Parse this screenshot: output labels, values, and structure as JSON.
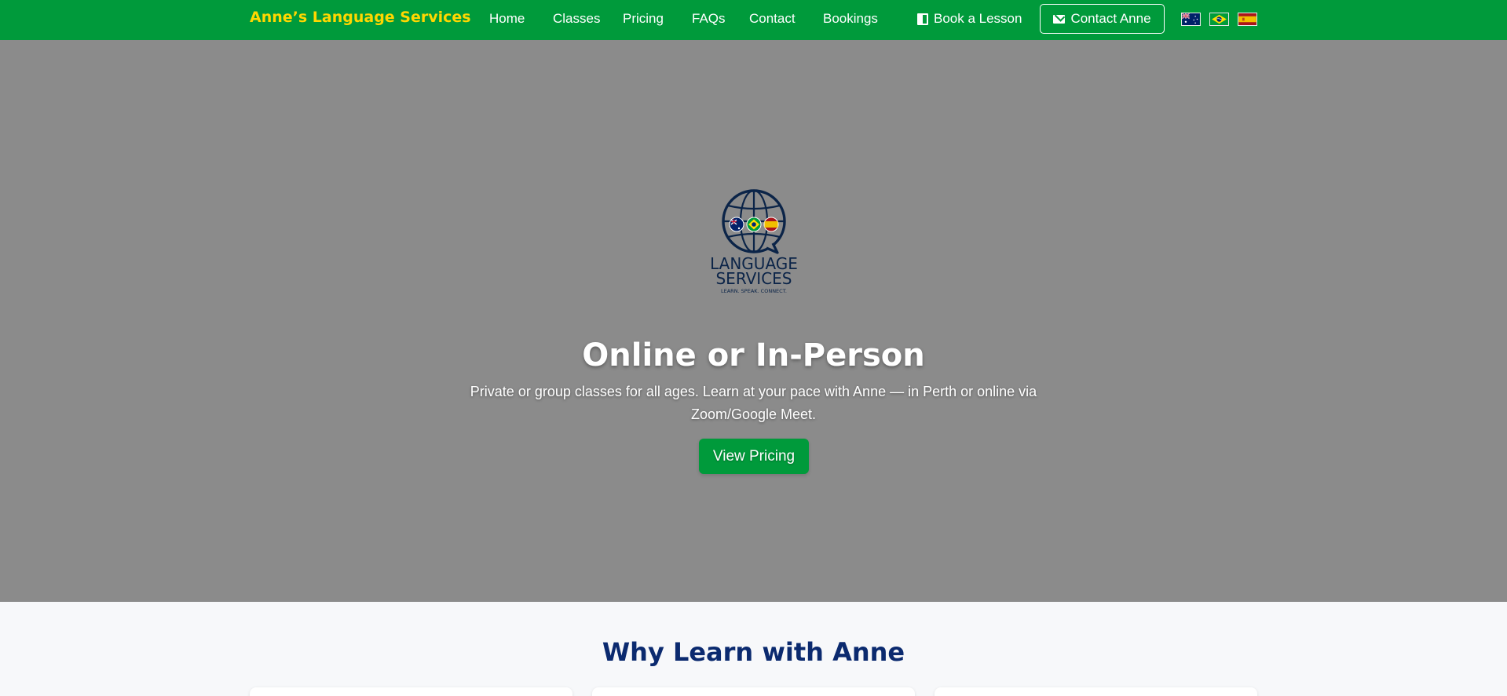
{
  "navbar": {
    "brand": "Anne’s Language Services",
    "links": [
      {
        "label": "Home"
      },
      {
        "label": "Classes"
      },
      {
        "label": "Pricing"
      },
      {
        "label": "FAQs"
      },
      {
        "label": "Contact"
      },
      {
        "label": "Bookings"
      }
    ],
    "book_label": "Book a Lesson",
    "contact_label": "Contact Anne",
    "flags": [
      {
        "icon": "australia-flag-icon"
      },
      {
        "icon": "brazil-flag-icon"
      },
      {
        "icon": "spain-flag-icon"
      }
    ]
  },
  "hero": {
    "logo": {
      "line1": "LANGUAGE",
      "line2": "SERVICES",
      "tagline": "LEARN. SPEAK. CONNECT."
    },
    "title": "Online or In-Person",
    "subtitle": "Private or group classes for all ages. Learn at your pace with Anne — in Perth or online via Zoom/Google Meet.",
    "cta_label": "View Pricing"
  },
  "why": {
    "title": "Why Learn with Anne"
  },
  "colors": {
    "nav_green": "#009a3b",
    "brand_yellow": "#ffd700",
    "hero_overlay": "#8b8b8b",
    "heading_navy": "#0b2a6f"
  }
}
